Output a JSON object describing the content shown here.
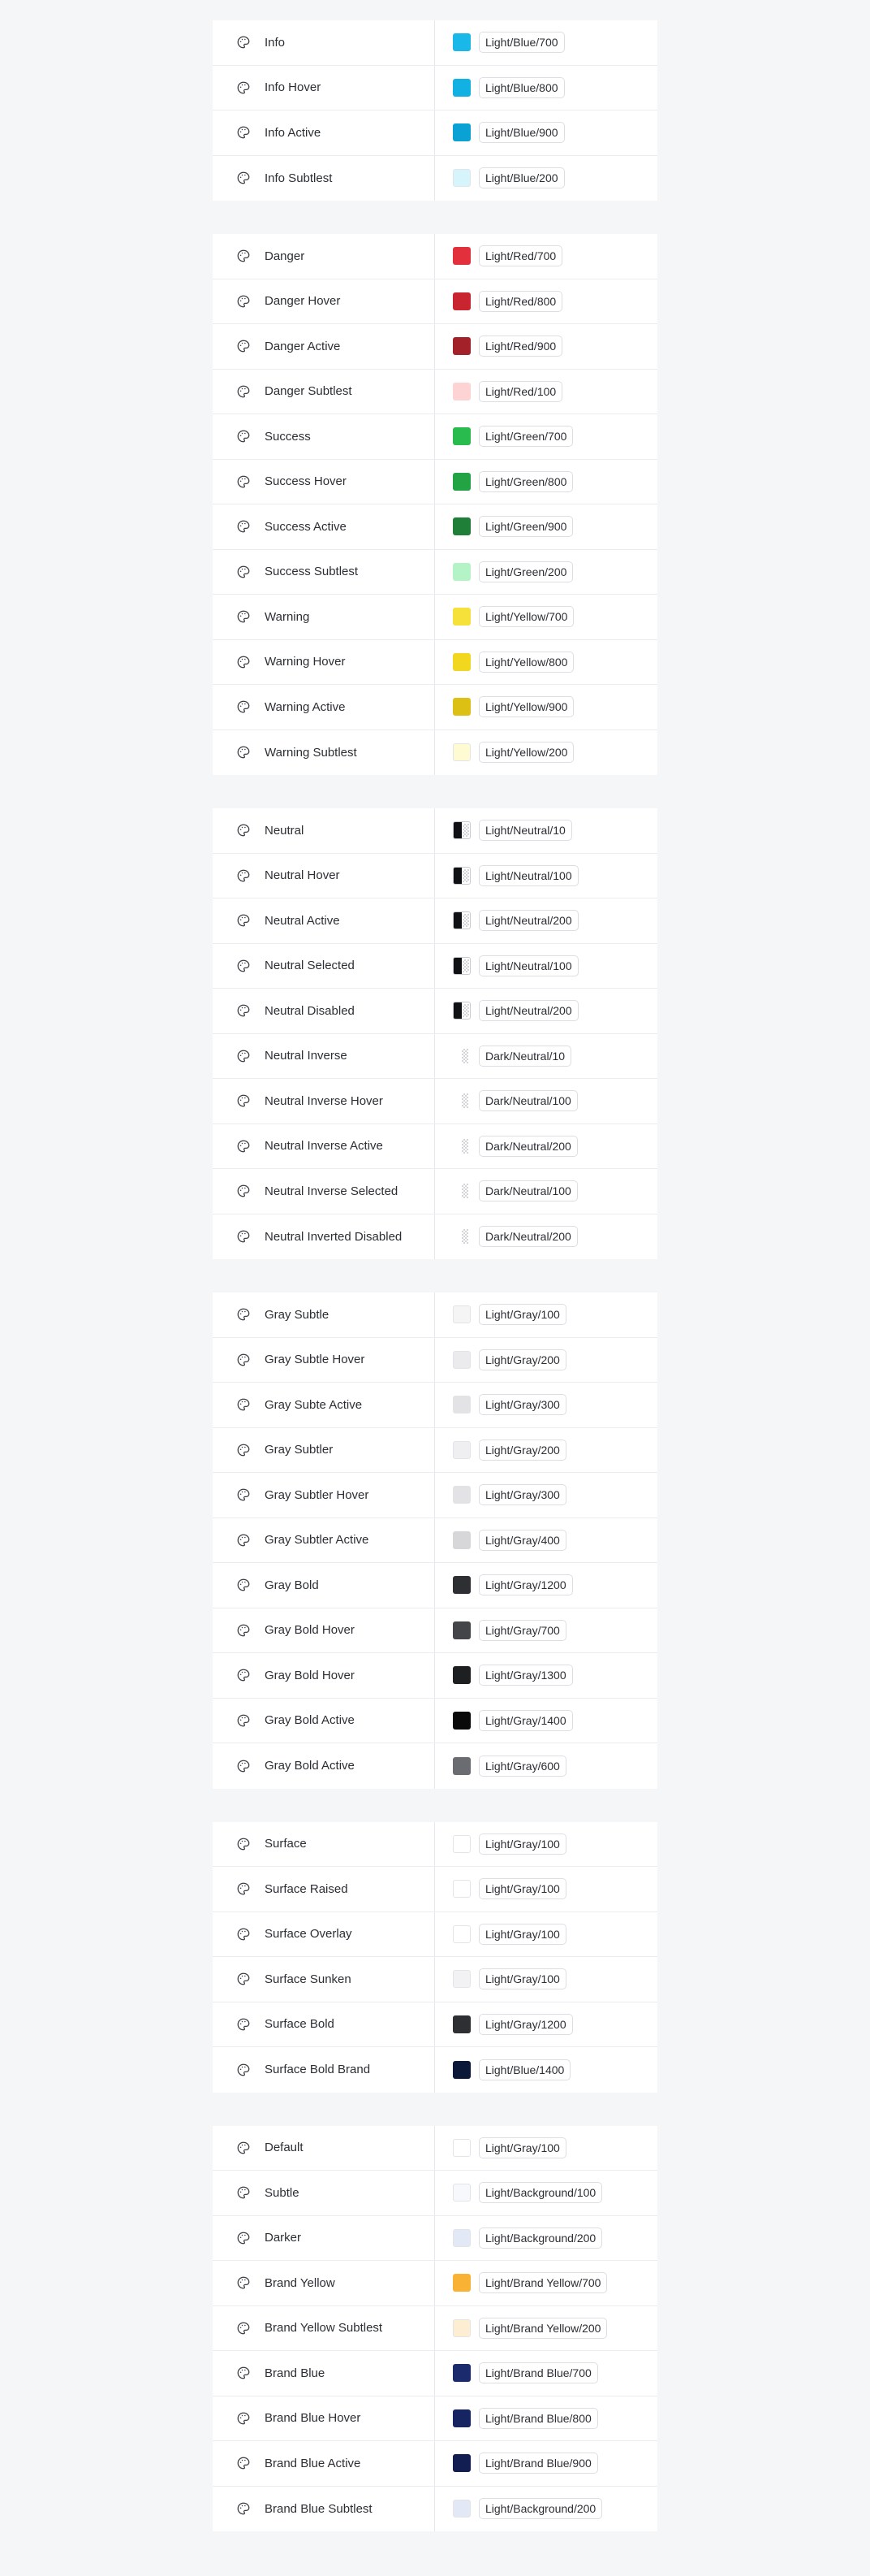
{
  "groups": [
    {
      "rows": [
        {
          "name": "Info",
          "token": "Light/Blue/700",
          "color": "#1ab8e8"
        },
        {
          "name": "Info Hover",
          "token": "Light/Blue/800",
          "color": "#12b1e4"
        },
        {
          "name": "Info Active",
          "token": "Light/Blue/900",
          "color": "#0aa2d4"
        },
        {
          "name": "Info Subtlest",
          "token": "Light/Blue/200",
          "color": "#d5f4fb"
        }
      ]
    },
    {
      "rows": [
        {
          "name": "Danger",
          "token": "Light/Red/700",
          "color": "#e2313d"
        },
        {
          "name": "Danger Hover",
          "token": "Light/Red/800",
          "color": "#c92530"
        },
        {
          "name": "Danger Active",
          "token": "Light/Red/900",
          "color": "#a3222a"
        },
        {
          "name": "Danger Subtlest",
          "token": "Light/Red/100",
          "color": "#fdd3d3"
        },
        {
          "name": "Success",
          "token": "Light/Green/700",
          "color": "#2abb4e"
        },
        {
          "name": "Success Hover",
          "token": "Light/Green/800",
          "color": "#23a343"
        },
        {
          "name": "Success Active",
          "token": "Light/Green/900",
          "color": "#1f7e37"
        },
        {
          "name": "Success Subtlest",
          "token": "Light/Green/200",
          "color": "#b3f3c6"
        },
        {
          "name": "Warning",
          "token": "Light/Yellow/700",
          "color": "#f6e03a"
        },
        {
          "name": "Warning Hover",
          "token": "Light/Yellow/800",
          "color": "#f1d81f"
        },
        {
          "name": "Warning Active",
          "token": "Light/Yellow/900",
          "color": "#dcc114"
        },
        {
          "name": "Warning Subtlest",
          "token": "Light/Yellow/200",
          "color": "#fefbd2"
        }
      ]
    },
    {
      "rows": [
        {
          "name": "Neutral",
          "token": "Light/Neutral/10",
          "swatch": "split"
        },
        {
          "name": "Neutral Hover",
          "token": "Light/Neutral/100",
          "swatch": "split"
        },
        {
          "name": "Neutral Active",
          "token": "Light/Neutral/200",
          "swatch": "split"
        },
        {
          "name": "Neutral Selected",
          "token": "Light/Neutral/100",
          "swatch": "split"
        },
        {
          "name": "Neutral Disabled",
          "token": "Light/Neutral/200",
          "swatch": "split"
        },
        {
          "name": "Neutral Inverse",
          "token": "Dark/Neutral/10",
          "swatch": "checker"
        },
        {
          "name": "Neutral Inverse Hover",
          "token": "Dark/Neutral/100",
          "swatch": "checker"
        },
        {
          "name": "Neutral Inverse Active",
          "token": "Dark/Neutral/200",
          "swatch": "checker"
        },
        {
          "name": "Neutral Inverse Selected",
          "token": "Dark/Neutral/100",
          "swatch": "checker"
        },
        {
          "name": "Neutral Inverted Disabled",
          "token": "Dark/Neutral/200",
          "swatch": "checker"
        }
      ]
    },
    {
      "rows": [
        {
          "name": "Gray Subtle",
          "token": "Light/Gray/100",
          "color": "#f5f5f6"
        },
        {
          "name": "Gray Subtle Hover",
          "token": "Light/Gray/200",
          "color": "#ebebee"
        },
        {
          "name": "Gray Subte Active",
          "token": "Light/Gray/300",
          "color": "#e3e3e6"
        },
        {
          "name": "Gray Subtler",
          "token": "Light/Gray/200",
          "color": "#efeff1"
        },
        {
          "name": "Gray Subtler Hover",
          "token": "Light/Gray/300",
          "color": "#e3e3e6"
        },
        {
          "name": "Gray Subtler Active",
          "token": "Light/Gray/400",
          "color": "#d7d7da"
        },
        {
          "name": "Gray Bold",
          "token": "Light/Gray/1200",
          "color": "#2e2f32"
        },
        {
          "name": "Gray Bold Hover",
          "token": "Light/Gray/700",
          "color": "#444549"
        },
        {
          "name": "Gray Bold Hover",
          "token": "Light/Gray/1300",
          "color": "#1e1f21"
        },
        {
          "name": "Gray Bold Active",
          "token": "Light/Gray/1400",
          "color": "#0a0a0b"
        },
        {
          "name": "Gray Bold Active",
          "token": "Light/Gray/600",
          "color": "#6b6c71"
        }
      ]
    },
    {
      "rows": [
        {
          "name": "Surface",
          "token": "Light/Gray/100",
          "color": "#ffffff"
        },
        {
          "name": "Surface Raised",
          "token": "Light/Gray/100",
          "color": "#ffffff"
        },
        {
          "name": "Surface Overlay",
          "token": "Light/Gray/100",
          "color": "#ffffff"
        },
        {
          "name": "Surface Sunken",
          "token": "Light/Gray/100",
          "color": "#f2f2f4"
        },
        {
          "name": "Surface Bold",
          "token": "Light/Gray/1200",
          "color": "#2e2f32"
        },
        {
          "name": "Surface Bold Brand",
          "token": "Light/Blue/1400",
          "color": "#0b1837"
        }
      ]
    },
    {
      "rows": [
        {
          "name": "Default",
          "token": "Light/Gray/100",
          "color": "#ffffff"
        },
        {
          "name": "Subtle",
          "token": "Light/Background/100",
          "color": "#f7f8fc"
        },
        {
          "name": "Darker",
          "token": "Light/Background/200",
          "color": "#e3e8f7"
        },
        {
          "name": "Brand Yellow",
          "token": "Light/Brand Yellow/700",
          "color": "#f9b233"
        },
        {
          "name": "Brand Yellow Subtlest",
          "token": "Light/Brand Yellow/200",
          "color": "#fdeed2"
        },
        {
          "name": "Brand Blue",
          "token": "Light/Brand Blue/700",
          "color": "#1a2a6c"
        },
        {
          "name": "Brand Blue Hover",
          "token": "Light/Brand Blue/800",
          "color": "#162462"
        },
        {
          "name": "Brand Blue Active",
          "token": "Light/Brand Blue/900",
          "color": "#121d52"
        },
        {
          "name": "Brand Blue Subtlest",
          "token": "Light/Background/200",
          "color": "#e3e8f7"
        }
      ]
    }
  ],
  "icon": "palette-icon"
}
